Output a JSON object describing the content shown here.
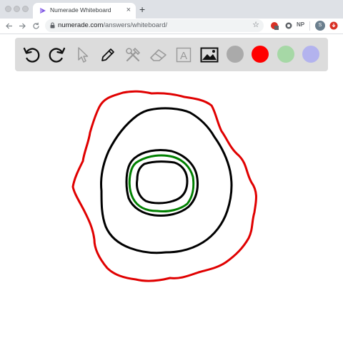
{
  "browser": {
    "tab_title": "Numerade Whiteboard",
    "tab_close": "×",
    "new_tab": "+",
    "url_host": "numerade.com",
    "url_path": "/answers/whiteboard/",
    "ext_np_label": "NP",
    "profile_initial": "S"
  },
  "whiteboard": {
    "tools": [
      {
        "icon": "undo-icon"
      },
      {
        "icon": "redo-icon"
      },
      {
        "icon": "cursor-icon"
      },
      {
        "icon": "pencil-icon"
      },
      {
        "icon": "tools-icon"
      },
      {
        "icon": "eraser-icon"
      },
      {
        "icon": "text-icon",
        "glyph": "A"
      },
      {
        "icon": "image-icon"
      }
    ],
    "colors": [
      "#aaaaaa",
      "#ff0000",
      "#a6d8a6",
      "#b3b3ee"
    ],
    "strokes": [
      {
        "color": "#e00000",
        "shape": "outer-irregular-loop"
      },
      {
        "color": "#000000",
        "shape": "middle-loop"
      },
      {
        "color": "#008000",
        "shape": "inner-loop"
      },
      {
        "color": "#000000",
        "shape": "inner-loop-pair"
      }
    ]
  }
}
